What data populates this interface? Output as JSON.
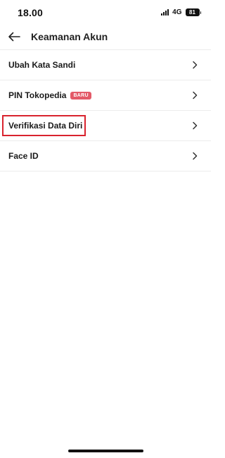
{
  "status_bar": {
    "time": "18.00",
    "network": "4G",
    "battery": "81",
    "signal_icon": "signal-bars-icon",
    "battery_icon": "battery-icon"
  },
  "header": {
    "title": "Keamanan Akun",
    "back_icon": "arrow-left-icon"
  },
  "menu": {
    "items": [
      {
        "label": "Ubah Kata Sandi",
        "badge": "",
        "icon": "chevron-right-icon"
      },
      {
        "label": "PIN Tokopedia",
        "badge": "BARU",
        "icon": "chevron-right-icon"
      },
      {
        "label": "Verifikasi Data Diri",
        "badge": "",
        "icon": "chevron-right-icon",
        "highlighted": true
      },
      {
        "label": "Face ID",
        "badge": "",
        "icon": "chevron-right-icon"
      }
    ]
  },
  "colors": {
    "badge": "#e35a68",
    "highlight": "#d9232e",
    "divider": "#ececec"
  }
}
